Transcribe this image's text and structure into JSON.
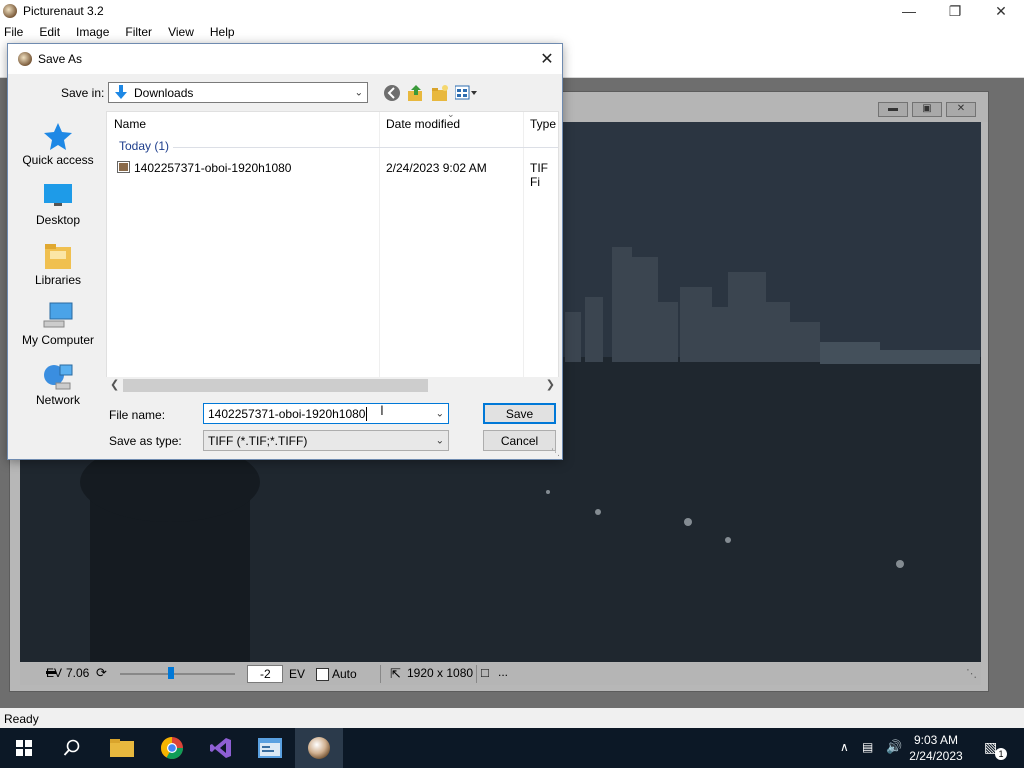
{
  "app": {
    "title": "Picturenaut 3.2",
    "menu": [
      "File",
      "Edit",
      "Image",
      "Filter",
      "View",
      "Help"
    ],
    "status": "Ready"
  },
  "image_window": {
    "ev_label": "EV",
    "ev_value": "7.06",
    "exposure_value": "-2",
    "exposure_unit": "EV",
    "auto_label": "Auto",
    "dimensions": "1920 x 1080",
    "more": "..."
  },
  "dialog": {
    "title": "Save As",
    "save_in_label": "Save in:",
    "save_in_value": "Downloads",
    "places": [
      {
        "label": "Quick access",
        "icon": "star-icon"
      },
      {
        "label": "Desktop",
        "icon": "desktop-icon"
      },
      {
        "label": "Libraries",
        "icon": "libraries-icon"
      },
      {
        "label": "My Computer",
        "icon": "computer-icon"
      },
      {
        "label": "Network",
        "icon": "network-icon"
      }
    ],
    "columns": [
      "Name",
      "Date modified",
      "Type"
    ],
    "group_header": "Today (1)",
    "files": [
      {
        "name": "1402257371-oboi-1920h1080",
        "date": "2/24/2023 9:02 AM",
        "type": "TIF Fi"
      }
    ],
    "file_name_label": "File name:",
    "file_name_value": "1402257371-oboi-1920h1080",
    "save_type_label": "Save as type:",
    "save_type_value": "TIFF (*.TIF;*.TIFF)",
    "save_button": "Save",
    "cancel_button": "Cancel"
  },
  "taskbar": {
    "time": "9:03 AM",
    "date": "2/24/2023",
    "notification_count": "1"
  },
  "colors": {
    "accent": "#0078d7",
    "taskbar": "#0c1826",
    "workspace": "#6e6e6e"
  }
}
